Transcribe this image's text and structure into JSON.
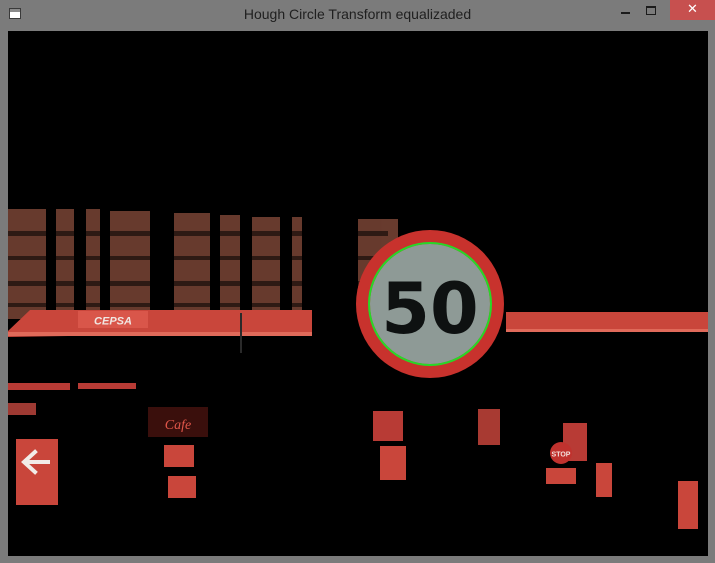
{
  "window": {
    "title": "Hough Circle Transform equalizaded",
    "close_glyph": "✕"
  },
  "image": {
    "sign_text": "50",
    "gas_brand_text": "CEPSA",
    "cafe_text": "Cafe",
    "stop_text": "STOP",
    "detected_circle_color": "#27d827",
    "sign_ring_color": "#c8322d",
    "sign_face_color": "#8e9a96"
  }
}
